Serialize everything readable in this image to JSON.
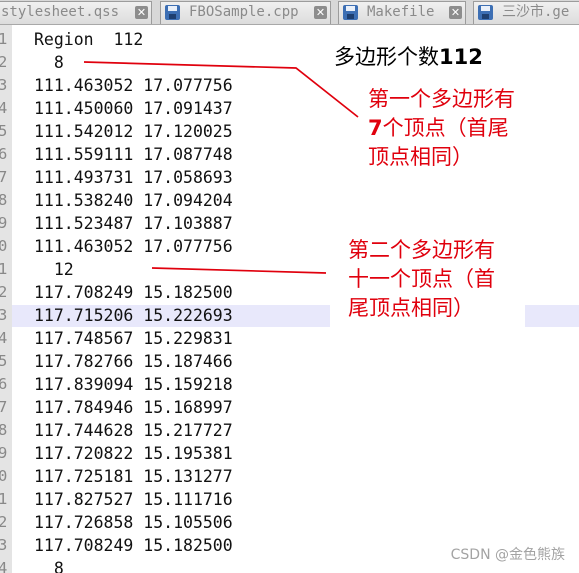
{
  "tabs": [
    {
      "label": "stylesheet.qss",
      "has_icon": false,
      "has_close": true
    },
    {
      "label": "FBOSample.cpp",
      "has_icon": true,
      "has_close": true
    },
    {
      "label": "Makefile",
      "has_icon": true,
      "has_close": true
    },
    {
      "label": "三沙市.ge",
      "has_icon": true,
      "has_close": false
    }
  ],
  "close_glyph": "✕",
  "line_numbers": [
    "1",
    "2",
    "3",
    "4",
    "5",
    "6",
    "7",
    "8",
    "9",
    "0",
    "1",
    "2",
    "3",
    "4",
    "5",
    "6",
    "7",
    "8",
    "9",
    "0",
    "1",
    "2",
    "3",
    "4"
  ],
  "lines": [
    "Region  112",
    "  8",
    "111.463052 17.077756",
    "111.450060 17.091437",
    "111.542012 17.120025",
    "111.559111 17.087748",
    "111.493731 17.058693",
    "111.538240 17.094204",
    "111.523487 17.103887",
    "111.463052 17.077756",
    "  12",
    "117.708249 15.182500",
    "117.715206 15.222693",
    "117.748567 15.229831",
    "117.782766 15.187466",
    "117.839094 15.159218",
    "117.784946 15.168997",
    "117.744628 15.217727",
    "117.720822 15.195381",
    "117.725181 15.131277",
    "117.827527 15.111716",
    "117.726858 15.105506",
    "117.708249 15.182500",
    "  8"
  ],
  "highlighted_line": 13,
  "annotations": {
    "title_text": "多边形个数",
    "title_number": "112",
    "note1_line1": "第一个多边形有",
    "note1_number": "7",
    "note1_line2_rest": "个顶点（首尾",
    "note1_line3": "顶点相同）",
    "note2_line1": "第二个多边形有",
    "note2_line2": "十一个顶点（首",
    "note2_line3": "尾顶点相同）",
    "arrow_color": "#e0000d"
  },
  "watermark": "CSDN @金色熊族"
}
